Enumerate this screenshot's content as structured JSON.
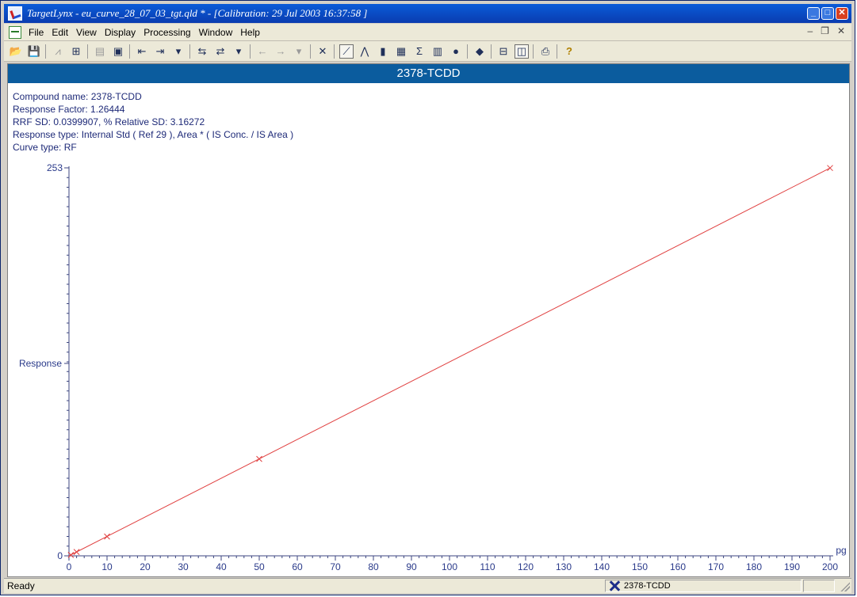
{
  "window": {
    "title": "TargetLynx - eu_curve_28_07_03_tgt.qld * - [Calibration: 29 Jul 2003 16:37:58 ]"
  },
  "menu": {
    "items": [
      "File",
      "Edit",
      "View",
      "Display",
      "Processing",
      "Window",
      "Help"
    ]
  },
  "toolbar": {
    "buttons": [
      {
        "name": "open-icon",
        "glyph": "📂"
      },
      {
        "name": "save-icon",
        "glyph": "💾"
      },
      {
        "name": "peak-icon",
        "glyph": "⩘"
      },
      {
        "name": "calibrate-icon",
        "glyph": "⊞"
      },
      {
        "name": "copy-icon",
        "glyph": "▤"
      },
      {
        "name": "display-icon",
        "glyph": "▣"
      },
      {
        "name": "prev-compound-icon",
        "glyph": "⇤"
      },
      {
        "name": "next-compound-icon",
        "glyph": "⇥"
      },
      {
        "name": "prev-sample-icon",
        "glyph": "⇆"
      },
      {
        "name": "next-sample-icon",
        "glyph": "⇄"
      },
      {
        "name": "undo-icon",
        "glyph": "←"
      },
      {
        "name": "redo-icon",
        "glyph": "→"
      },
      {
        "name": "exclude-point-icon",
        "glyph": "✕"
      },
      {
        "name": "calibration-view-icon",
        "glyph": "⟋"
      },
      {
        "name": "chromatogram-view-icon",
        "glyph": "⋀"
      },
      {
        "name": "bar-view-icon",
        "glyph": "▮"
      },
      {
        "name": "table-view-icon",
        "glyph": "▦"
      },
      {
        "name": "summary-icon",
        "glyph": "Σ"
      },
      {
        "name": "book-icon",
        "glyph": "▥"
      },
      {
        "name": "globe-icon",
        "glyph": "●"
      },
      {
        "name": "report-icon",
        "glyph": "◆"
      },
      {
        "name": "split-horizontal-icon",
        "glyph": "⊟"
      },
      {
        "name": "split-vertical-icon",
        "glyph": "◫"
      },
      {
        "name": "print-icon",
        "glyph": "⎙"
      },
      {
        "name": "help-icon",
        "glyph": "?"
      }
    ]
  },
  "compound": {
    "header": "2378-TCDD",
    "lines": [
      "Compound name: 2378-TCDD",
      "Response Factor: 1.26444",
      "RRF SD: 0.0399907,  % Relative SD: 3.16272",
      "Response type: Internal Std ( Ref 29 ), Area * ( IS Conc. / IS Area )",
      "Curve type: RF"
    ]
  },
  "chart_data": {
    "type": "scatter",
    "title": "",
    "xlabel": "pg",
    "ylabel": "Response",
    "xlim": [
      0,
      200
    ],
    "ylim": [
      0,
      253
    ],
    "x_ticks": [
      0,
      10,
      20,
      30,
      40,
      50,
      60,
      70,
      80,
      90,
      100,
      110,
      120,
      130,
      140,
      150,
      160,
      170,
      180,
      190,
      200
    ],
    "y_tick_labels": [
      "0",
      "253"
    ],
    "series": [
      {
        "points": [
          [
            0.5,
            0.6
          ],
          [
            2,
            2.5
          ],
          [
            10,
            12.6
          ],
          [
            50,
            63.2
          ],
          [
            200,
            252.9
          ]
        ],
        "fit_line": [
          [
            0,
            0
          ],
          [
            200,
            252.9
          ]
        ],
        "color": "#e04040"
      }
    ]
  },
  "status": {
    "text": "Ready",
    "compound": "2378-TCDD"
  }
}
